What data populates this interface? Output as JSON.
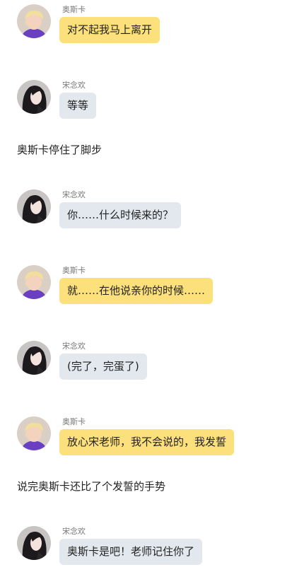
{
  "colors": {
    "bubble_yellow": "#fce07c",
    "bubble_grey": "#e3e8ef",
    "name_text": "#777777",
    "body_text": "#222222"
  },
  "speakers": {
    "oska": {
      "name": "奥斯卡",
      "avatar_icon": "blonde-boy-purple-shirt-avatar"
    },
    "song": {
      "name": "宋念欢",
      "avatar_icon": "dark-haired-girl-avatar"
    }
  },
  "items": [
    {
      "type": "message",
      "speaker": "oska",
      "name": "奥斯卡",
      "text": "对不起我马上离开"
    },
    {
      "type": "message",
      "speaker": "song",
      "name": "宋念欢",
      "text": "等等"
    },
    {
      "type": "narration",
      "text": "奥斯卡停住了脚步"
    },
    {
      "type": "message",
      "speaker": "song",
      "name": "宋念欢",
      "text": "你……什么时候来的？"
    },
    {
      "type": "message",
      "speaker": "oska",
      "name": "奥斯卡",
      "text": "就……在他说亲你的时候……"
    },
    {
      "type": "message",
      "speaker": "song",
      "name": "宋念欢",
      "text": "(完了，完蛋了)"
    },
    {
      "type": "message",
      "speaker": "oska",
      "name": "奥斯卡",
      "text": "放心宋老师，我不会说的，我发誓"
    },
    {
      "type": "narration",
      "text": "说完奥斯卡还比了个发誓的手势"
    },
    {
      "type": "message",
      "speaker": "song",
      "name": "宋念欢",
      "text": "奥斯卡是吧！老师记住你了"
    }
  ]
}
